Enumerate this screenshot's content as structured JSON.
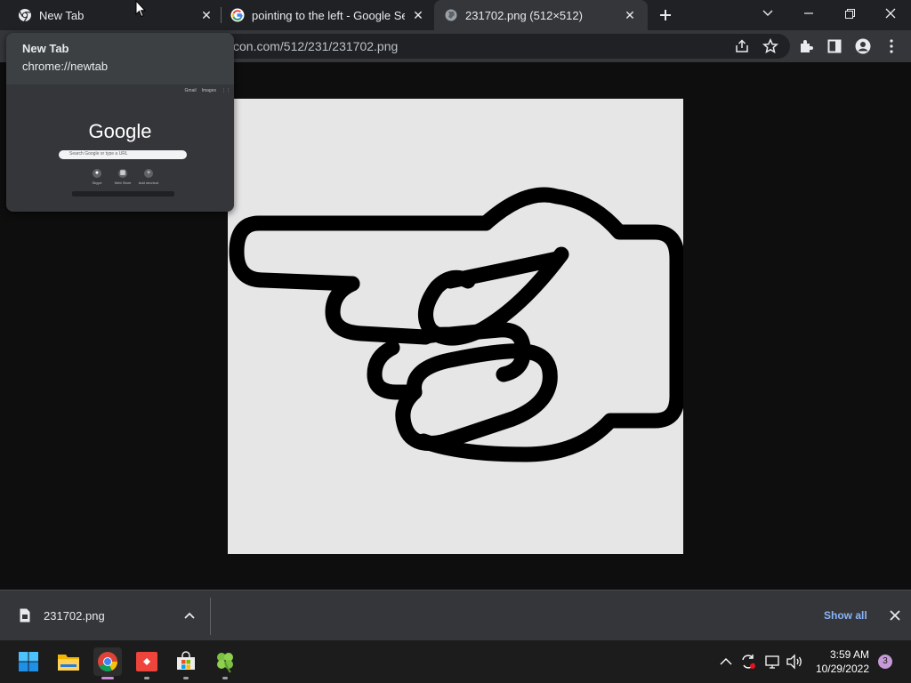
{
  "tabs": [
    {
      "title": "New Tab",
      "icon": "chrome-icon"
    },
    {
      "title": "pointing to the left - Google Sear",
      "icon": "google-icon"
    },
    {
      "title": "231702.png (512×512)",
      "icon": "globe-icon"
    }
  ],
  "address_bar": {
    "url": "con.com/512/231/231702.png"
  },
  "hover_card": {
    "title": "New Tab",
    "url": "chrome://newtab",
    "preview": {
      "top_links": [
        "Gmail",
        "Images"
      ],
      "logo_text": "Google",
      "search_placeholder": "Search Google or type a URL",
      "shortcuts": [
        "Skype",
        "Web Store",
        "Add shortcut"
      ]
    }
  },
  "image": {
    "icon": "hand-pointing-left-icon"
  },
  "download_bar": {
    "file_name": "231702.png",
    "show_all_label": "Show all"
  },
  "taskbar": {
    "apps": [
      "start-icon",
      "file-explorer-icon",
      "chrome-icon",
      "anydesk-icon",
      "store-icon",
      "clover-icon"
    ],
    "time": "3:59 AM",
    "date": "10/29/2022",
    "notification_count": "3"
  },
  "colors": {
    "tab_strip": "#202124",
    "toolbar": "#35363a",
    "page_background": "#0e0e0e",
    "image_background": "#e6e6e6",
    "link_blue": "#8ab4f8"
  }
}
